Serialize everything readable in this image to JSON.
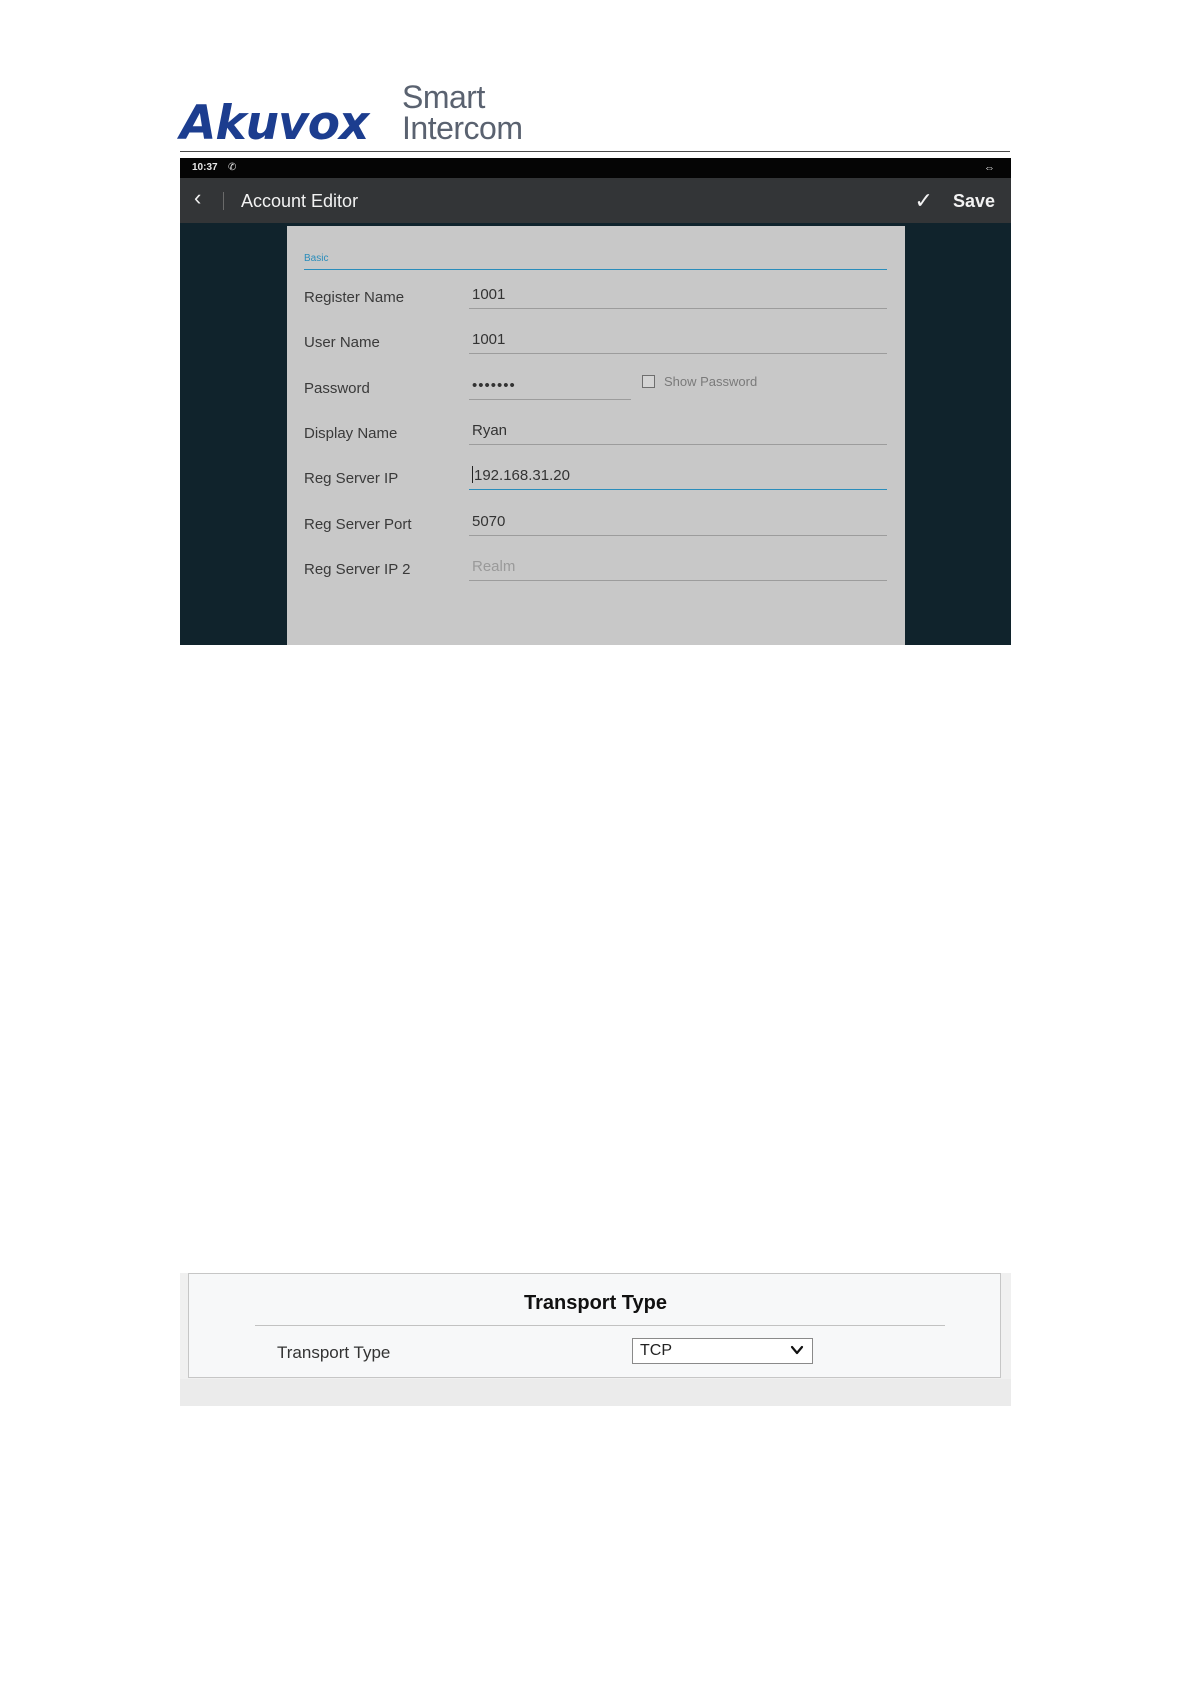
{
  "header": {
    "brand": "Akuvox",
    "tagline_line1": "Smart",
    "tagline_line2": "Intercom"
  },
  "account_editor": {
    "status_bar": {
      "time": "10:37",
      "call_icon": "phone-icon",
      "link_icon": "link-arrows-icon"
    },
    "app_bar": {
      "back_icon": "chevron-left-icon",
      "title": "Account Editor",
      "save_icon": "checkmark-icon",
      "save_label": "Save"
    },
    "section_label": "Basic",
    "fields": {
      "register_name": {
        "label": "Register Name",
        "value": "1001"
      },
      "user_name": {
        "label": "User Name",
        "value": "1001"
      },
      "password": {
        "label": "Password",
        "value": "•••••••"
      },
      "show_password": {
        "label": "Show Password",
        "checked": false
      },
      "display_name": {
        "label": "Display Name",
        "value": "Ryan"
      },
      "reg_server_ip": {
        "label": "Reg Server IP",
        "value": "192.168.31.20"
      },
      "reg_server_port": {
        "label": "Reg Server Port",
        "value": "5070"
      },
      "reg_server_ip_2": {
        "label": "Reg Server IP 2",
        "placeholder": "Realm"
      }
    },
    "colors": {
      "accent": "#2a8dbb",
      "panel": "#c8c8c8",
      "app_bar": "#333537",
      "background": "#10232c"
    }
  },
  "transport": {
    "title": "Transport Type",
    "label": "Transport Type",
    "selected": "TCP"
  }
}
